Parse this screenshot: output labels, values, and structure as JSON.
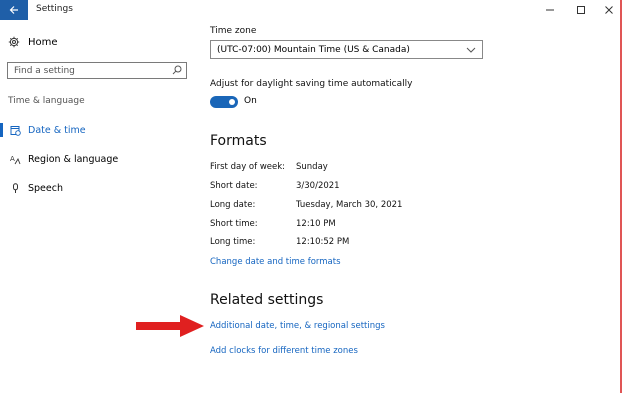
{
  "window": {
    "title": "Settings"
  },
  "sidebar": {
    "home_label": "Home",
    "search_placeholder": "Find a setting",
    "section_label": "Time & language",
    "items": [
      {
        "label": "Date & time",
        "selected": true
      },
      {
        "label": "Region & language",
        "selected": false
      },
      {
        "label": "Speech",
        "selected": false
      }
    ]
  },
  "main": {
    "time_zone_label": "Time zone",
    "time_zone_value": "(UTC-07:00) Mountain Time (US & Canada)",
    "dst_label": "Adjust for daylight saving time automatically",
    "dst_toggle_state": "On",
    "formats_heading": "Formats",
    "formats": [
      {
        "key": "First day of week:",
        "value": "Sunday"
      },
      {
        "key": "Short date:",
        "value": "3/30/2021"
      },
      {
        "key": "Long date:",
        "value": "Tuesday, March 30, 2021"
      },
      {
        "key": "Short time:",
        "value": "12:10 PM"
      },
      {
        "key": "Long time:",
        "value": "12:10:52 PM"
      }
    ],
    "change_formats_link": "Change date and time formats",
    "related_heading": "Related settings",
    "related_links": [
      "Additional date, time, & regional settings",
      "Add clocks for different time zones"
    ]
  },
  "colors": {
    "accent": "#1565c0",
    "annotation_arrow": "#e02020"
  }
}
